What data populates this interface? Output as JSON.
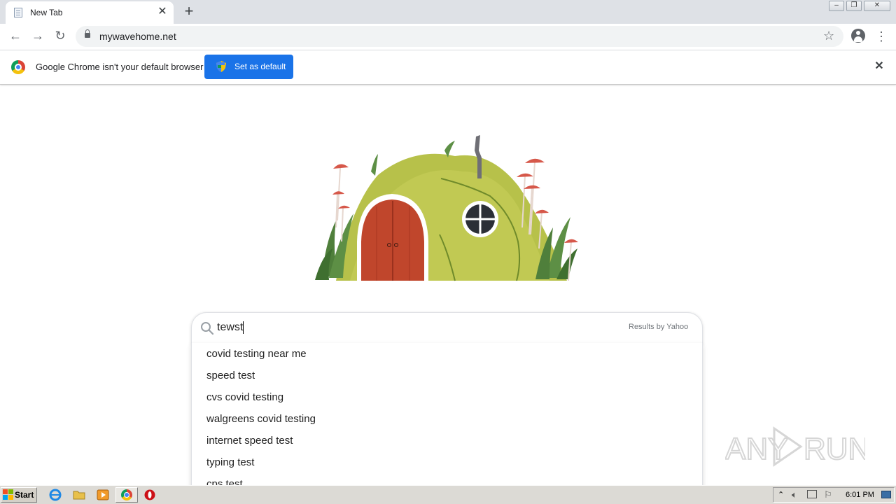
{
  "browser": {
    "tab": {
      "title": "New Tab"
    },
    "address": {
      "url": "mywavehome.net"
    }
  },
  "infobar": {
    "message": "Google Chrome isn't your default browser",
    "button_label": "Set as default"
  },
  "search": {
    "query": "tewst",
    "provider_text": "Results by Yahoo",
    "suggestions": [
      "covid testing near me",
      "speed test",
      "cvs covid testing",
      "walgreens covid testing",
      "internet speed test",
      "typing test",
      "cps test"
    ]
  },
  "watermark": {
    "text": "ANY RUN"
  },
  "taskbar": {
    "start_label": "Start",
    "clock": "6:01 PM"
  },
  "colors": {
    "accent": "#1a73e8",
    "titlebar": "#dee1e6",
    "taskbar": "#dcdad5"
  },
  "icons": [
    "page-icon",
    "close-icon",
    "plus-icon",
    "back-arrow-icon",
    "forward-arrow-icon",
    "reload-icon",
    "lock-icon",
    "star-icon",
    "profile-icon",
    "more-vert-icon",
    "chrome-logo-icon",
    "shield-icon",
    "search-icon",
    "windows-logo-icon",
    "ie-icon",
    "folder-icon",
    "media-player-icon",
    "chrome-icon",
    "opera-icon"
  ]
}
